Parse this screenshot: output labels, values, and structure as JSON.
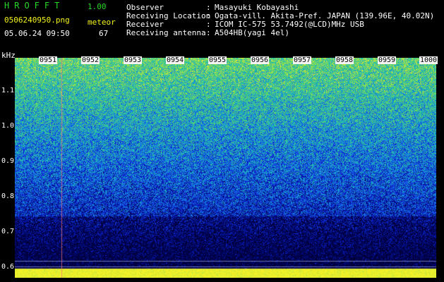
{
  "header": {
    "logo": "HROFFT",
    "version": "1.00",
    "filename": "0506240950.png",
    "mode": "meteor",
    "datetime": "05.06.24 09:50",
    "count": "67"
  },
  "meta": [
    {
      "label": "Observer",
      "value": "Masayuki Kobayashi"
    },
    {
      "label": "Receiving Location",
      "value": "Ogata-vill. Akita-Pref. JAPAN (139.96E, 40.02N)"
    },
    {
      "label": "Receiver",
      "value": "ICOM IC-575 53.7492(@LCD)MHz USB"
    },
    {
      "label": "Receiving antenna",
      "value": "A504HB(yagi 4el)"
    }
  ],
  "spectrogram": {
    "unit": "kHz",
    "y_ticks": [
      "1.1",
      "1.0",
      "0.9",
      "0.8",
      "0.7",
      "0.6"
    ],
    "time_labels": [
      "0951",
      "0952",
      "0953",
      "0954",
      "0955",
      "0956",
      "0957",
      "0958",
      "0959",
      "1000"
    ]
  },
  "colors": {
    "logo_text": "#27d627",
    "accent_text": "#f2f21a",
    "background": "#000000",
    "time_marker": "#f4f4f4"
  }
}
